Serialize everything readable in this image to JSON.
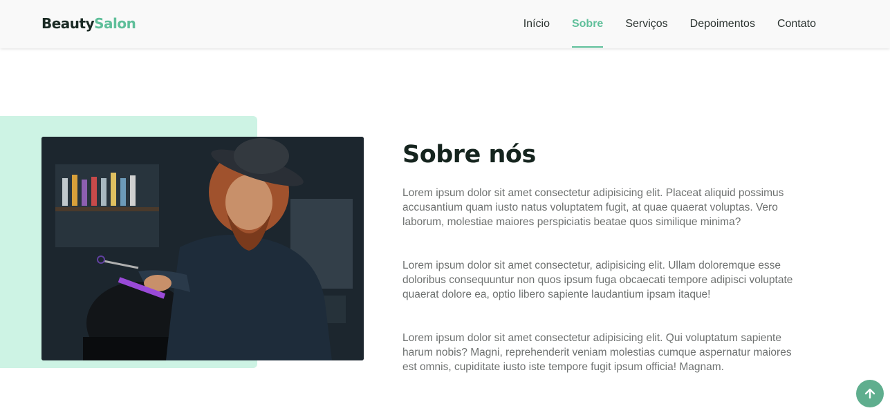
{
  "header": {
    "logo_part1": "Beauty",
    "logo_part2": "Salon",
    "nav": [
      {
        "label": "Início",
        "active": false
      },
      {
        "label": "Sobre",
        "active": true
      },
      {
        "label": "Serviços",
        "active": false
      },
      {
        "label": "Depoimentos",
        "active": false
      },
      {
        "label": "Contato",
        "active": false
      }
    ]
  },
  "about": {
    "title": "Sobre nós",
    "paragraphs": [
      "Lorem ipsum dolor sit amet consectetur adipisicing elit. Placeat aliquid possimus accusantium quam iusto natus voluptatem fugit, at quae quaerat voluptas. Vero laborum, molestiae maiores perspiciatis beatae quos similique minima?",
      "Lorem ipsum dolor sit amet consectetur, adipisicing elit. Ullam doloremque esse doloribus consequuntur non quos ipsum fuga obcaecati tempore adipisci voluptate quaerat dolore ea, optio libero sapiente laudantium ipsam itaque!",
      "Lorem ipsum dolor sit amet consectetur adipisicing elit. Qui voluptatum sapiente harum nobis? Magni, reprehenderit veniam molestias cumque aspernatur maiores est omnis, cupiditate iusto iste tempore fugit ipsum officia! Magnam."
    ]
  },
  "icons": {
    "back_to_top": "arrow-up-icon"
  },
  "colors": {
    "accent": "#5fbf9a",
    "mint_block": "#cdf3e4",
    "heading": "#15241e",
    "body_text": "#6e7170",
    "back_to_top_bg": "#5fae8e"
  }
}
